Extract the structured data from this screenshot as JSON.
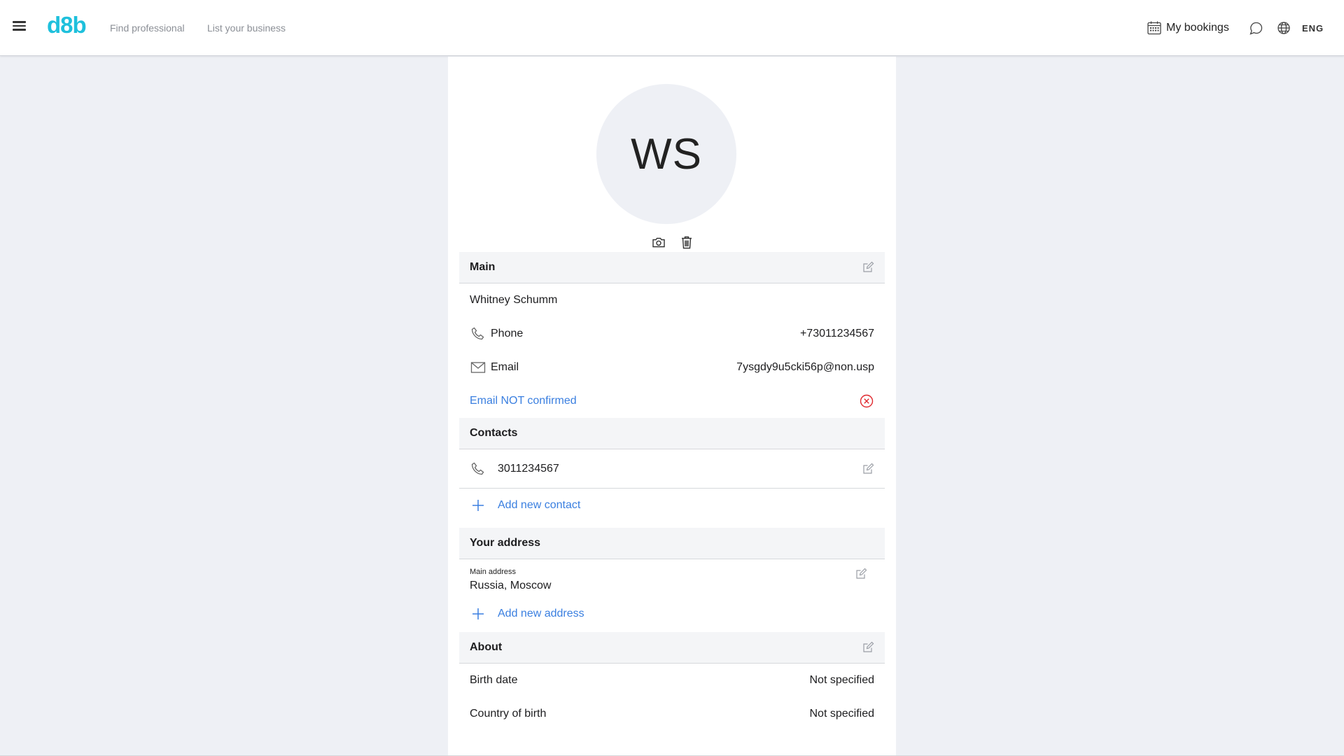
{
  "header": {
    "logo": "d8b",
    "nav": {
      "find": "Find professional",
      "list": "List your business"
    },
    "bookings": "My bookings",
    "language": "ENG"
  },
  "profile": {
    "initials": "WS"
  },
  "main": {
    "title": "Main",
    "name": "Whitney Schumm",
    "phone_label": "Phone",
    "phone_value": "+73011234567",
    "email_label": "Email",
    "email_value": "7ysgdy9u5cki56p@non.usp",
    "email_status": "Email NOT confirmed"
  },
  "contacts": {
    "title": "Contacts",
    "items": [
      {
        "type": "phone",
        "value": "3011234567"
      }
    ],
    "add_label": "Add new contact"
  },
  "address": {
    "title": "Your address",
    "main_label": "Main address",
    "main_value": "Russia, Moscow",
    "add_label": "Add new address"
  },
  "about": {
    "title": "About",
    "birth_date_label": "Birth date",
    "birth_date_value": "Not specified",
    "country_label": "Country of birth",
    "country_value": "Not specified"
  },
  "colors": {
    "brand": "#1ec0dc",
    "link": "#3a7fe0",
    "error": "#e0282e",
    "background": "#eef0f5"
  },
  "icons": [
    "menu-icon",
    "calendar-icon",
    "chat-icon",
    "globe-icon",
    "camera-icon",
    "trash-icon",
    "edit-icon",
    "phone-icon",
    "mail-icon",
    "error-circle-icon",
    "plus-icon"
  ]
}
